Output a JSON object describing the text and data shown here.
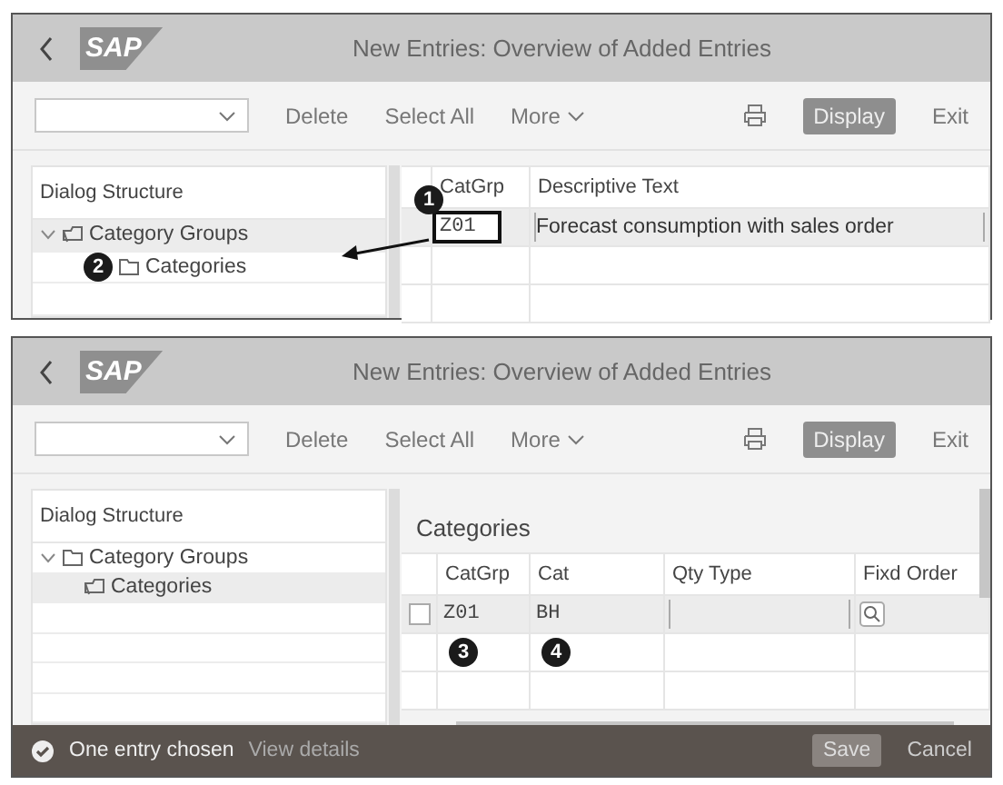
{
  "screens": [
    {
      "header": {
        "logo": "SAP",
        "title": "New Entries: Overview of Added Entries"
      },
      "toolbar": {
        "items": [
          {
            "kind": "dropdown"
          },
          {
            "kind": "link",
            "label": "Delete"
          },
          {
            "kind": "link",
            "label": "Select All"
          },
          {
            "kind": "menu",
            "label": "More"
          },
          {
            "kind": "print"
          },
          {
            "kind": "primary",
            "label": "Display"
          },
          {
            "kind": "link",
            "label": "Exit"
          }
        ]
      },
      "tree": {
        "title": "Dialog Structure",
        "items": [
          {
            "label": "Category Groups",
            "expanded": true,
            "selected": true,
            "children": [
              {
                "label": "Categories",
                "selected": false,
                "callout": "2"
              }
            ]
          }
        ]
      },
      "table": {
        "columns": [
          "CatGrp",
          "Descriptive Text"
        ],
        "rows": [
          {
            "cells": [
              {
                "kind": "key",
                "text": "Z01",
                "highlighted": true,
                "callout": "1"
              },
              {
                "kind": "input",
                "text": "Forecast consumption with sales order"
              }
            ]
          }
        ]
      },
      "arrow": true
    },
    {
      "header": {
        "logo": "SAP",
        "title": "New Entries: Overview of Added Entries"
      },
      "toolbar": {
        "items": [
          {
            "kind": "dropdown"
          },
          {
            "kind": "link",
            "label": "Delete"
          },
          {
            "kind": "link",
            "label": "Select All"
          },
          {
            "kind": "menu",
            "label": "More"
          },
          {
            "kind": "print"
          },
          {
            "kind": "primary",
            "label": "Display"
          },
          {
            "kind": "link",
            "label": "Exit"
          }
        ]
      },
      "tree": {
        "title": "Dialog Structure",
        "items": [
          {
            "label": "Category Groups",
            "expanded": true,
            "selected": false,
            "children": [
              {
                "label": "Categories",
                "selected": true
              }
            ]
          }
        ]
      },
      "table": {
        "title": "Categories",
        "columns": [
          "CatGrp",
          "Cat",
          "Qty Type",
          "Fixd Order"
        ],
        "rows": [
          {
            "checked": false,
            "cells": [
              {
                "kind": "key",
                "text": "Z01",
                "highlighted": false,
                "callout_below": "3"
              },
              {
                "kind": "key",
                "text": "BH",
                "highlighted": false,
                "callout_below": "4"
              },
              {
                "kind": "input"
              },
              {
                "kind": "lookup"
              }
            ]
          }
        ]
      },
      "footer": {
        "message": "One entry chosen",
        "link": "View details",
        "buttons": [
          {
            "kind": "primary",
            "label": "Save"
          },
          {
            "kind": "link",
            "label": "Cancel"
          }
        ]
      }
    }
  ]
}
